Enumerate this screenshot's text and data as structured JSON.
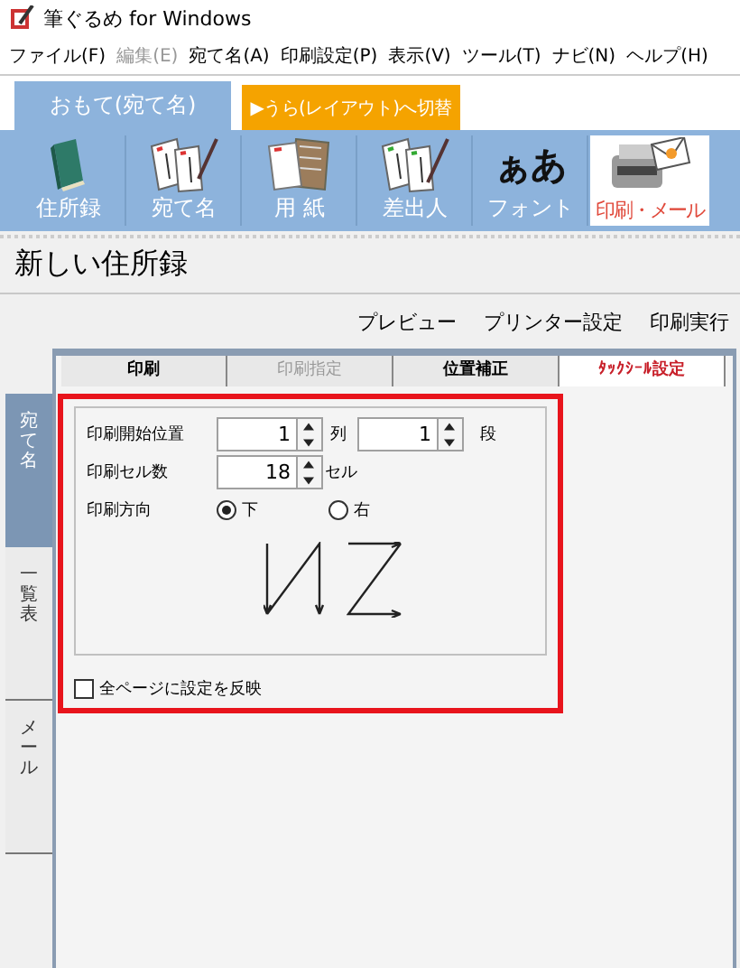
{
  "window": {
    "title": "筆ぐるめ for Windows"
  },
  "menu": [
    {
      "label": "ファイル(F)",
      "disabled": false
    },
    {
      "label": "編集(E)",
      "disabled": true
    },
    {
      "label": "宛て名(A)",
      "disabled": false
    },
    {
      "label": "印刷設定(P)",
      "disabled": false
    },
    {
      "label": "表示(V)",
      "disabled": false
    },
    {
      "label": "ツール(T)",
      "disabled": false
    },
    {
      "label": "ナビ(N)",
      "disabled": false
    },
    {
      "label": "ヘルプ(H)",
      "disabled": false
    }
  ],
  "mode_tabs": [
    {
      "label": "おもて(宛て名)",
      "selected": true
    },
    {
      "label": "▶うら(レイアウト)へ切替",
      "selected": false
    }
  ],
  "toolbar": [
    {
      "kind": "book",
      "label": "住所録",
      "selected": false
    },
    {
      "kind": "cards",
      "label": "宛て名",
      "selected": false
    },
    {
      "kind": "paper",
      "label": "用 紙",
      "selected": false
    },
    {
      "kind": "sender",
      "label": "差出人",
      "selected": false
    },
    {
      "kind": "font",
      "icon_text": "ぁあ",
      "label": "フォント",
      "selected": false
    },
    {
      "kind": "print",
      "label": "印刷・メール",
      "selected": true
    }
  ],
  "heading": "新しい住所録",
  "actions": [
    "プレビュー",
    "プリンター設定",
    "印刷実行"
  ],
  "side_tabs": [
    {
      "label": "宛て名",
      "selected": true
    },
    {
      "label": "一覧表",
      "selected": false
    },
    {
      "label": "メール",
      "selected": false
    }
  ],
  "panel_tabs": [
    {
      "label": "印刷",
      "selected": false,
      "disabled": false
    },
    {
      "label": "印刷指定",
      "selected": false,
      "disabled": true
    },
    {
      "label": "位置補正",
      "selected": false,
      "disabled": false
    },
    {
      "label": "ﾀｯｸｼｰﾙ設定",
      "selected": true,
      "disabled": false
    }
  ],
  "start_position": {
    "label": "印刷開始位置",
    "column_value": "1",
    "column_unit": "列",
    "row_value": "1",
    "row_unit": "段"
  },
  "cell_count": {
    "label": "印刷セル数",
    "value": "18",
    "unit": "セル"
  },
  "direction": {
    "label": "印刷方向",
    "options": [
      {
        "label": "下",
        "selected": true
      },
      {
        "label": "右",
        "selected": false
      }
    ]
  },
  "apply_all": {
    "label": "全ページに設定を反映",
    "checked": false
  }
}
